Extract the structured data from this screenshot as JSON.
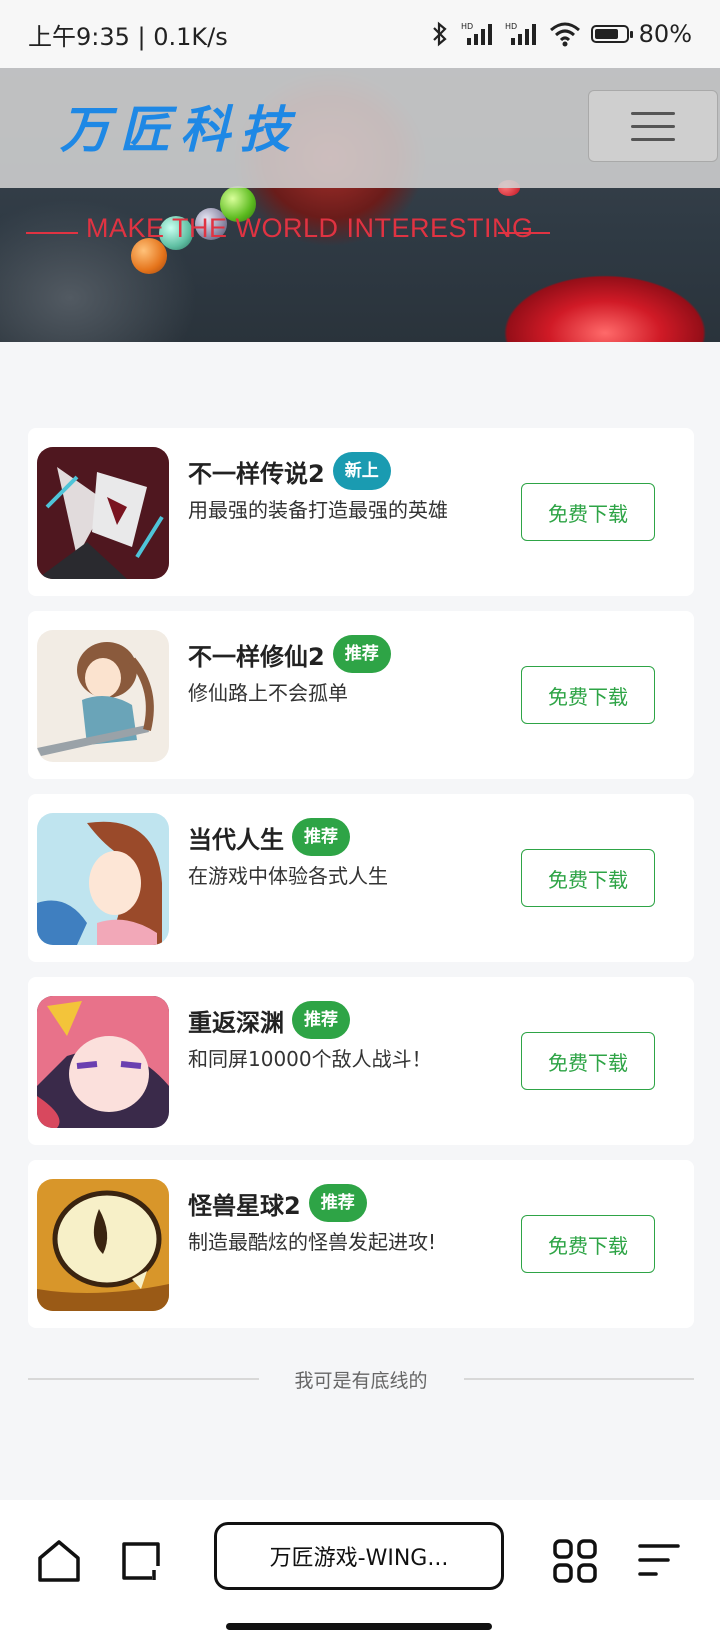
{
  "status_bar": {
    "time_and_speed": "上午9:35 | 0.1K/s",
    "battery": "80%",
    "battery_level": 0.8
  },
  "header": {
    "logo": "万匠科技",
    "slogan": "MAKE THE WORLD INTERESTING"
  },
  "games": [
    {
      "title": "不一样传说2",
      "badge": "新上",
      "badge_color": "#1a9bb1",
      "description": "用最强的装备打造最强的英雄",
      "download_label": "免费下载",
      "thumb_icon": "legend-game-icon"
    },
    {
      "title": "不一样修仙2",
      "badge": "推荐",
      "badge_color": "#2ea446",
      "description": "修仙路上不会孤单",
      "download_label": "免费下载",
      "thumb_icon": "cultivation-game-icon"
    },
    {
      "title": "当代人生",
      "badge": "推荐",
      "badge_color": "#2ea446",
      "description": "在游戏中体验各式人生",
      "download_label": "免费下载",
      "thumb_icon": "life-game-icon"
    },
    {
      "title": "重返深渊",
      "badge": "推荐",
      "badge_color": "#2ea446",
      "description": "和同屏10000个敌人战斗！",
      "download_label": "免费下载",
      "thumb_icon": "abyss-game-icon"
    },
    {
      "title": "怪兽星球2",
      "badge": "推荐",
      "badge_color": "#2ea446",
      "description": "制造最酷炫的怪兽发起进攻!",
      "download_label": "免费下载",
      "thumb_icon": "monster-game-icon"
    }
  ],
  "footer": {
    "end_text": "我可是有底线的"
  },
  "browser": {
    "address": "万匠游戏-WING..."
  }
}
